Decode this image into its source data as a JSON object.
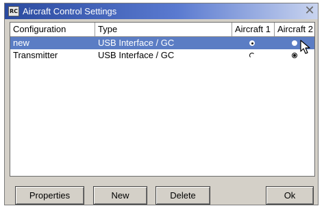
{
  "window": {
    "title": "Aircraft Control Settings",
    "icon": "app-icon",
    "icon_text": "RC"
  },
  "table": {
    "columns": [
      "Configuration",
      "Type",
      "Aircraft 1",
      "Aircraft 2"
    ],
    "rows": [
      {
        "configuration": "new",
        "type": "USB Interface / GC",
        "aircraft1": true,
        "aircraft2": false,
        "selected": true
      },
      {
        "configuration": "Transmitter",
        "type": "USB Interface / GC",
        "aircraft1": false,
        "aircraft2": true,
        "selected": false
      }
    ]
  },
  "buttons": {
    "properties": "Properties",
    "new": "New",
    "delete": "Delete",
    "ok": "Ok"
  },
  "colors": {
    "selection": "#5b7dc4",
    "titlebar_start": "#2a4a9f",
    "titlebar_end": "#c9d4ef",
    "face": "#d4d0c8"
  }
}
